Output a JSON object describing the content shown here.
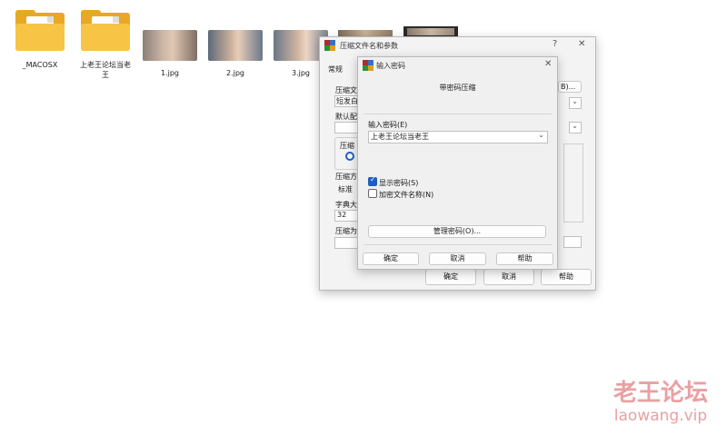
{
  "desktop": {
    "files": [
      {
        "name": "_MACOSX",
        "type": "folder"
      },
      {
        "name": "上老王论坛当老王",
        "type": "folder"
      },
      {
        "name": "1.jpg",
        "type": "image"
      },
      {
        "name": "2.jpg",
        "type": "image"
      },
      {
        "name": "3.jpg",
        "type": "image"
      }
    ]
  },
  "archive_dialog": {
    "title": "压缩文件名和参数",
    "help_icon": "?",
    "close_icon": "✕",
    "tab_general": "常规",
    "partial_labels": [
      "压缩文",
      "短发白",
      "默认配",
      "压缩",
      "压缩方",
      "标准",
      "字典大",
      "32",
      "压缩为"
    ],
    "partial_right": "B)...",
    "ok_label": "确定",
    "cancel_label": "取消",
    "help_label": "帮助"
  },
  "password_dialog": {
    "title": "输入密码",
    "close_icon": "✕",
    "heading": "带密码压缩",
    "password_label": "输入密码(E)",
    "password_value": "上老王论坛当老王",
    "show_password_label": "显示密码(S)",
    "show_password_checked": true,
    "encrypt_names_label": "加密文件名称(N)",
    "encrypt_names_checked": false,
    "manage_label": "管理密码(O)...",
    "ok_label": "确定",
    "cancel_label": "取消",
    "help_label": "帮助"
  },
  "watermark": {
    "line1": "老王论坛",
    "line2": "laowang.vip"
  },
  "colors": {
    "folder": "#f8c446",
    "accent": "#1e5fbf",
    "watermark": "#e9a0a2"
  }
}
